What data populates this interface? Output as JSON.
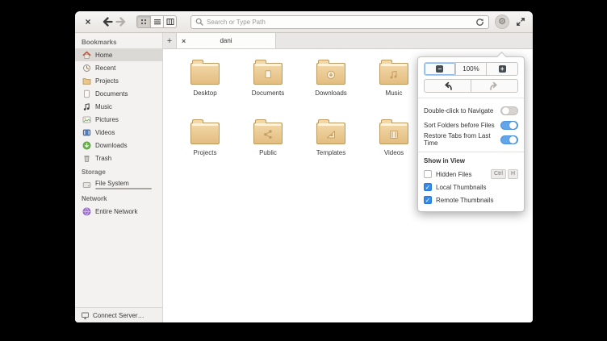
{
  "icons": {
    "close": "×",
    "add_tab": "+",
    "gear": "⚙",
    "zoom_out": "−",
    "zoom_in": "+",
    "check": "✓"
  },
  "toolbar": {
    "search_placeholder": "Search or Type Path"
  },
  "tabs": {
    "active_title": "dani"
  },
  "sidebar": {
    "sections": [
      {
        "header": "Bookmarks",
        "items": [
          {
            "label": "Home"
          },
          {
            "label": "Recent"
          },
          {
            "label": "Projects"
          },
          {
            "label": "Documents"
          },
          {
            "label": "Music"
          },
          {
            "label": "Pictures"
          },
          {
            "label": "Videos"
          },
          {
            "label": "Downloads"
          },
          {
            "label": "Trash"
          }
        ]
      },
      {
        "header": "Storage",
        "items": [
          {
            "label": "File System"
          }
        ]
      },
      {
        "header": "Network",
        "items": [
          {
            "label": "Entire Network"
          }
        ]
      }
    ],
    "connect_server_label": "Connect Server…"
  },
  "files": [
    {
      "label": "Desktop"
    },
    {
      "label": "Documents"
    },
    {
      "label": "Downloads"
    },
    {
      "label": "Music"
    },
    {
      "label": "Projects"
    },
    {
      "label": "Public"
    },
    {
      "label": "Templates"
    },
    {
      "label": "Videos"
    }
  ],
  "menu": {
    "zoom_level": "100%",
    "toggles": [
      {
        "label": "Double-click to Navigate",
        "on": false
      },
      {
        "label": "Sort Folders before Files",
        "on": true
      },
      {
        "label": "Restore Tabs from Last Time",
        "on": true
      }
    ],
    "section_header": "Show in View",
    "checks": [
      {
        "label": "Hidden Files",
        "checked": false,
        "shortcut": [
          "Ctrl",
          "H"
        ]
      },
      {
        "label": "Local Thumbnails",
        "checked": true
      },
      {
        "label": "Remote Thumbnails",
        "checked": true
      }
    ]
  },
  "colors": {
    "accent": "#3689e6",
    "toggle_on": "#62a6e9",
    "folder_body": "#e7c288",
    "sidebar_selection": "#dbd9d6"
  }
}
